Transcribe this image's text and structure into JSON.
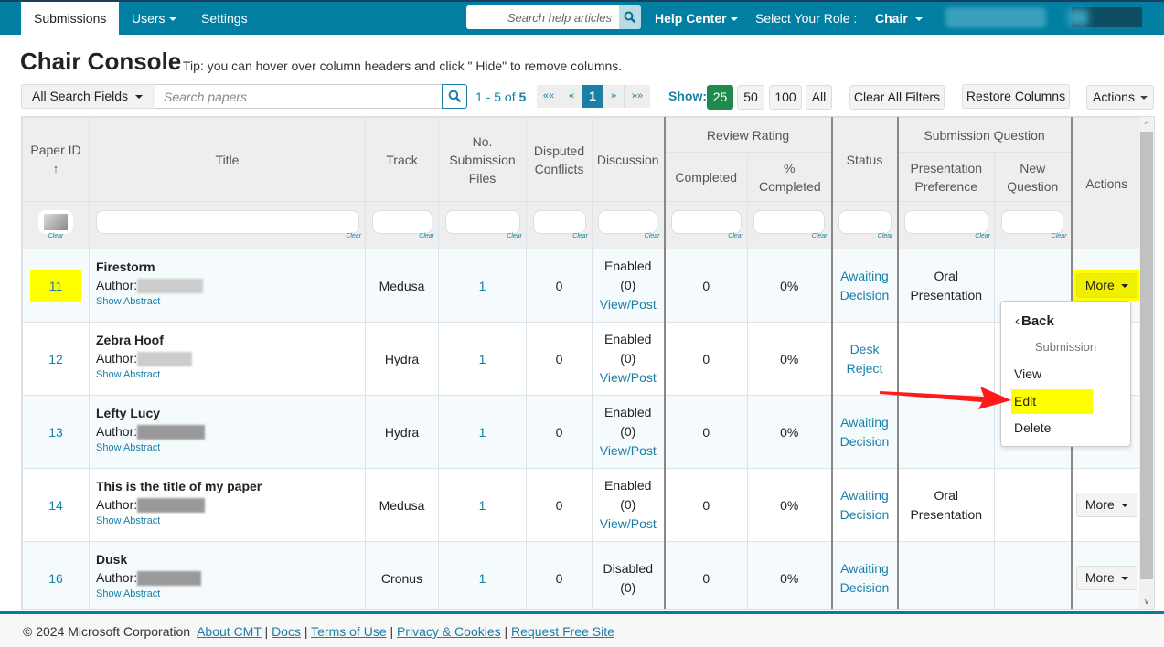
{
  "nav": {
    "tabs": [
      {
        "label": "Submissions",
        "active": true
      },
      {
        "label": "Users",
        "has_menu": true
      },
      {
        "label": "Settings"
      }
    ],
    "help_search_placeholder": "Search help articles",
    "help_center_label": "Help Center",
    "role_label": "Select Your Role :",
    "role_value": "Chair"
  },
  "page": {
    "title": "Chair Console",
    "tip": "Tip: you can hover over column headers and click \" Hide\" to remove columns."
  },
  "toolbar": {
    "search_field_select": "All Search Fields",
    "search_placeholder": "Search papers",
    "range_prefix": "1 - 5 of ",
    "range_total": "5",
    "pager": [
      "««",
      "«",
      "1",
      "»",
      "»»"
    ],
    "current_page": "1",
    "show_label": "Show:",
    "page_sizes": [
      "25",
      "50",
      "100",
      "All"
    ],
    "selected_page_size": "25",
    "clear_filters_label": "Clear All Filters",
    "restore_columns_label": "Restore Columns",
    "actions_label": "Actions"
  },
  "table": {
    "headers": {
      "paper_id": "Paper ID",
      "sort_indicator": "↑",
      "title": "Title",
      "track": "Track",
      "files": "No. Submission Files",
      "conflicts": "Disputed Conflicts",
      "discussion": "Discussion",
      "review_rating_group": "Review Rating",
      "completed": "Completed",
      "pct_completed": "% Completed",
      "status": "Status",
      "submission_question_group": "Submission Question",
      "presentation_pref": "Presentation Preference",
      "new_question": "New Question",
      "actions": "Actions"
    },
    "filter_clear_label": "Clear",
    "author_label": "Author:",
    "show_abstract_label": "Show Abstract",
    "more_label": "More",
    "rows": [
      {
        "id": "11",
        "title": "Firestorm",
        "track": "Medusa",
        "files": "1",
        "conflicts": "0",
        "discussion": "Enabled",
        "discussion_count": "(0)",
        "discussion_link": "View/Post",
        "completed": "0",
        "pct": "0%",
        "status": "Awaiting Decision",
        "presentation": "Oral Presentation",
        "new_question": "",
        "highlighted": true
      },
      {
        "id": "12",
        "title": "Zebra Hoof",
        "track": "Hydra",
        "files": "1",
        "conflicts": "0",
        "discussion": "Enabled",
        "discussion_count": "(0)",
        "discussion_link": "View/Post",
        "completed": "0",
        "pct": "0%",
        "status": "Desk Reject",
        "presentation": "",
        "new_question": ""
      },
      {
        "id": "13",
        "title": "Lefty Lucy",
        "track": "Hydra",
        "files": "1",
        "conflicts": "0",
        "discussion": "Enabled",
        "discussion_count": "(0)",
        "discussion_link": "View/Post",
        "completed": "0",
        "pct": "0%",
        "status": "Awaiting Decision",
        "presentation": "",
        "new_question": ""
      },
      {
        "id": "14",
        "title": "This is the title of my paper",
        "track": "Medusa",
        "files": "1",
        "conflicts": "0",
        "discussion": "Enabled",
        "discussion_count": "(0)",
        "discussion_link": "View/Post",
        "completed": "0",
        "pct": "0%",
        "status": "Awaiting Decision",
        "presentation": "Oral Presentation",
        "new_question": ""
      },
      {
        "id": "16",
        "title": "Dusk",
        "track": "Cronus",
        "files": "1",
        "conflicts": "0",
        "discussion": "Disabled",
        "discussion_count": "(0)",
        "discussion_link": "",
        "completed": "0",
        "pct": "0%",
        "status": "Awaiting Decision",
        "presentation": "",
        "new_question": ""
      }
    ]
  },
  "dropdown": {
    "back_label": "Back",
    "section_header": "Submission",
    "items": [
      "View",
      "Edit",
      "Delete"
    ],
    "highlighted_item": "Edit"
  },
  "footer": {
    "copyright": "© 2024 Microsoft Corporation",
    "links": [
      "About CMT",
      "Docs",
      "Terms of Use",
      "Privacy & Cookies",
      "Request Free Site"
    ]
  },
  "colors": {
    "brand": "#007fa3",
    "link": "#1a7fa6",
    "selected_page_size": "#1e8a4e",
    "highlight": "#ffff00",
    "annotation_arrow": "#ff0000"
  }
}
